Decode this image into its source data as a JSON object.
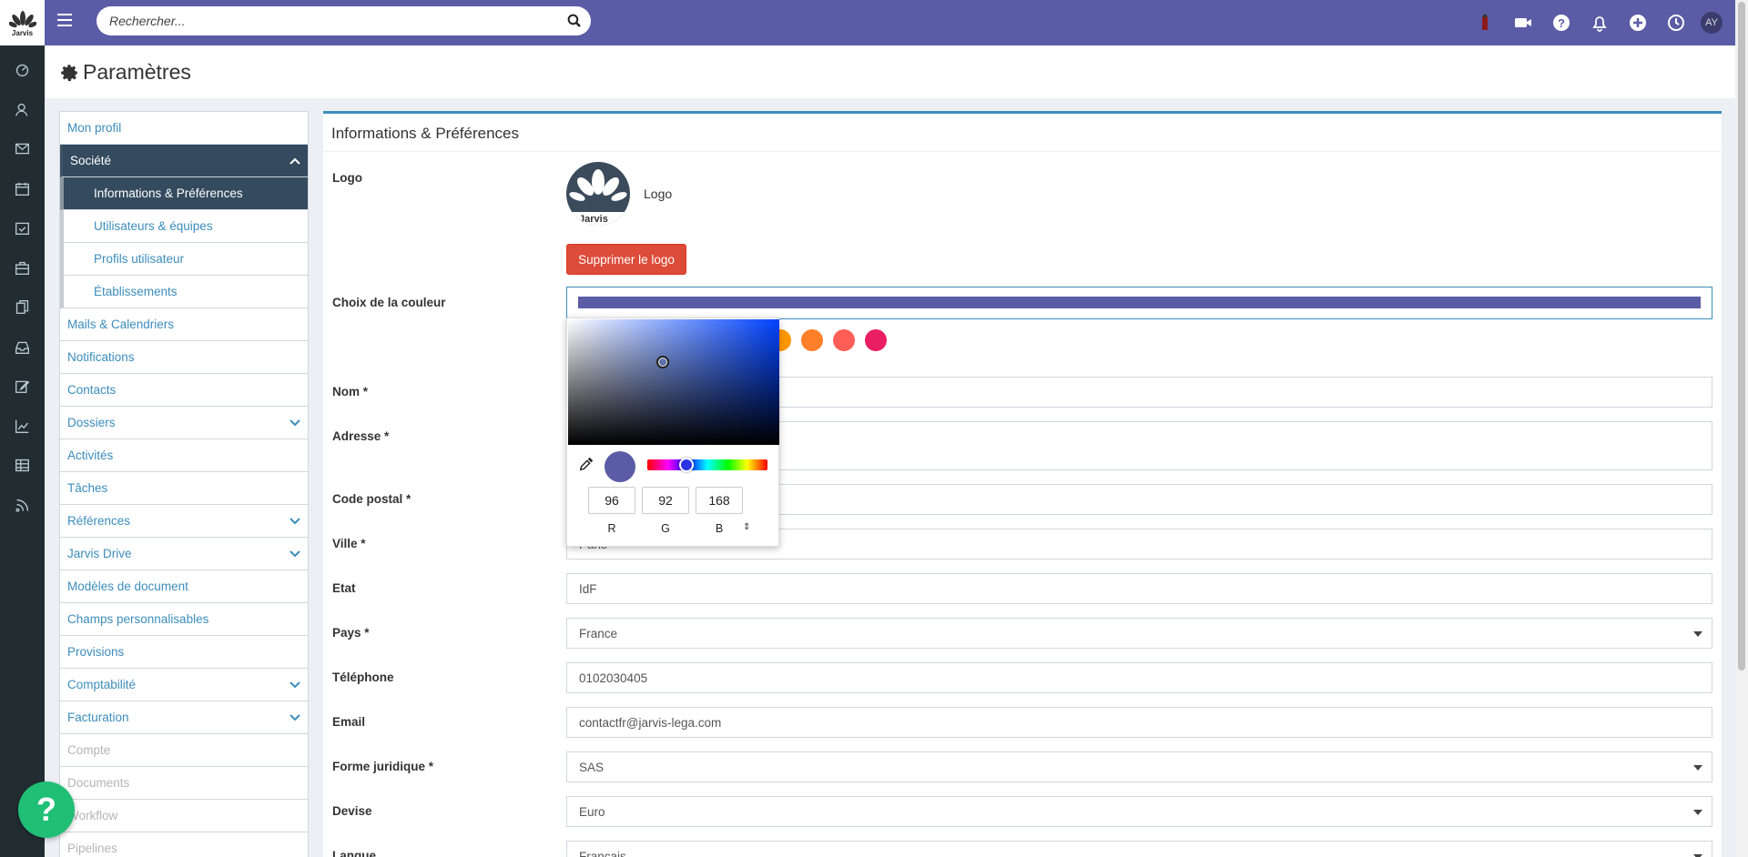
{
  "search": {
    "placeholder": "Rechercher..."
  },
  "user": {
    "initials": "AY"
  },
  "app": {
    "brand": "Jarvis"
  },
  "page": {
    "title": "Paramètres"
  },
  "settings_nav": [
    {
      "label": "Mon profil"
    },
    {
      "label": "Société"
    },
    {
      "label": "Informations & Préférences"
    },
    {
      "label": "Utilisateurs & équipes"
    },
    {
      "label": "Profils utilisateur"
    },
    {
      "label": "Établissements"
    },
    {
      "label": "Mails & Calendriers"
    },
    {
      "label": "Notifications"
    },
    {
      "label": "Contacts"
    },
    {
      "label": "Dossiers"
    },
    {
      "label": "Activités"
    },
    {
      "label": "Tâches"
    },
    {
      "label": "Références"
    },
    {
      "label": "Jarvis Drive"
    },
    {
      "label": "Modèles de document"
    },
    {
      "label": "Champs personnalisables"
    },
    {
      "label": "Provisions"
    },
    {
      "label": "Comptabilité"
    },
    {
      "label": "Facturation"
    },
    {
      "label": "Compte"
    },
    {
      "label": "Documents"
    },
    {
      "label": "Workflow"
    },
    {
      "label": "Pipelines"
    }
  ],
  "panel": {
    "title": "Informations & Préférences",
    "logo_label": "Logo",
    "logo_text": "Logo",
    "delete_logo": "Supprimer le logo",
    "color_label": "Choix de la couleur",
    "fields": {
      "nom": {
        "label": "Nom *",
        "value": ""
      },
      "adresse": {
        "label": "Adresse *",
        "value": ""
      },
      "code_postal": {
        "label": "Code postal *",
        "value": ""
      },
      "ville": {
        "label": "Ville *",
        "value": "Paris"
      },
      "etat": {
        "label": "Etat",
        "value": "IdF"
      },
      "pays": {
        "label": "Pays *",
        "value": "France"
      },
      "telephone": {
        "label": "Téléphone",
        "value": "0102030405"
      },
      "email": {
        "label": "Email",
        "value": "contactfr@jarvis-lega.com"
      },
      "forme": {
        "label": "Forme juridique *",
        "value": "SAS"
      },
      "devise": {
        "label": "Devise",
        "value": "Euro"
      },
      "langue": {
        "label": "Langue",
        "value": "Français"
      }
    }
  },
  "color_picker": {
    "r": "96",
    "g": "92",
    "b": "168",
    "r_label": "R",
    "g_label": "G",
    "b_label": "B",
    "toggle": "⇕",
    "selected_color": "#5b5ca6"
  },
  "swatches": [
    "#ff9800",
    "#ff7f2a",
    "#ff5e57",
    "#e91e63"
  ],
  "colors": {
    "topbar": "#5b5ca6",
    "rail": "#222d32",
    "nav_active": "#344a5e",
    "link": "#3c8dbc",
    "danger": "#dd4b39",
    "help": "#1fbf76"
  },
  "help_button": {
    "label": "?"
  }
}
